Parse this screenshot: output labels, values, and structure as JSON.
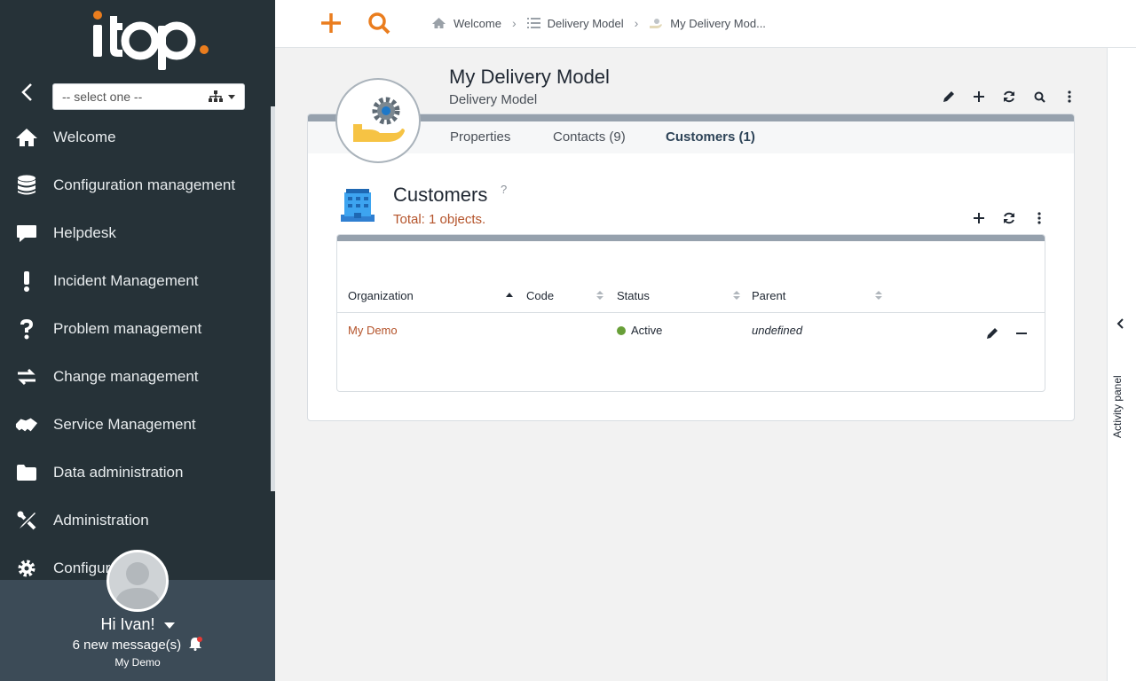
{
  "sidebar": {
    "org_select_placeholder": "-- select one --",
    "menu": [
      {
        "label": "Welcome",
        "icon": "home-icon"
      },
      {
        "label": "Configuration management",
        "icon": "database-icon"
      },
      {
        "label": "Helpdesk",
        "icon": "chat-icon"
      },
      {
        "label": "Incident Management",
        "icon": "exclamation-icon"
      },
      {
        "label": "Problem management",
        "icon": "question-icon"
      },
      {
        "label": "Change management",
        "icon": "exchange-icon"
      },
      {
        "label": "Service Management",
        "icon": "handshake-icon"
      },
      {
        "label": "Data administration",
        "icon": "folder-icon"
      },
      {
        "label": "Administration",
        "icon": "tools-icon"
      },
      {
        "label": "Configur",
        "icon": "gear-icon"
      }
    ],
    "user": {
      "greeting": "Hi Ivan!",
      "messages": "6 new message(s)",
      "organization": "My Demo"
    }
  },
  "topbar": {
    "breadcrumbs": [
      "Welcome",
      "Delivery Model",
      "My Delivery Mod..."
    ]
  },
  "activity_panel": {
    "label": "Activity panel"
  },
  "object": {
    "title": "My Delivery Model",
    "subtitle": "Delivery Model",
    "tabs": [
      "Properties",
      "Contacts (9)",
      "Customers (1)"
    ],
    "active_tab": "Customers (1)"
  },
  "section": {
    "title": "Customers",
    "help": "?",
    "total": "Total: 1 objects."
  },
  "table": {
    "columns": [
      "Organization",
      "Code",
      "Status",
      "Parent"
    ],
    "rows": [
      {
        "organization": "My Demo",
        "code": "",
        "status": "Active",
        "parent": "undefined"
      }
    ]
  },
  "colors": {
    "accent": "#ea7d1e",
    "link": "#b4532a",
    "sidebar_bg": "#263238",
    "status_active": "#689f38"
  }
}
